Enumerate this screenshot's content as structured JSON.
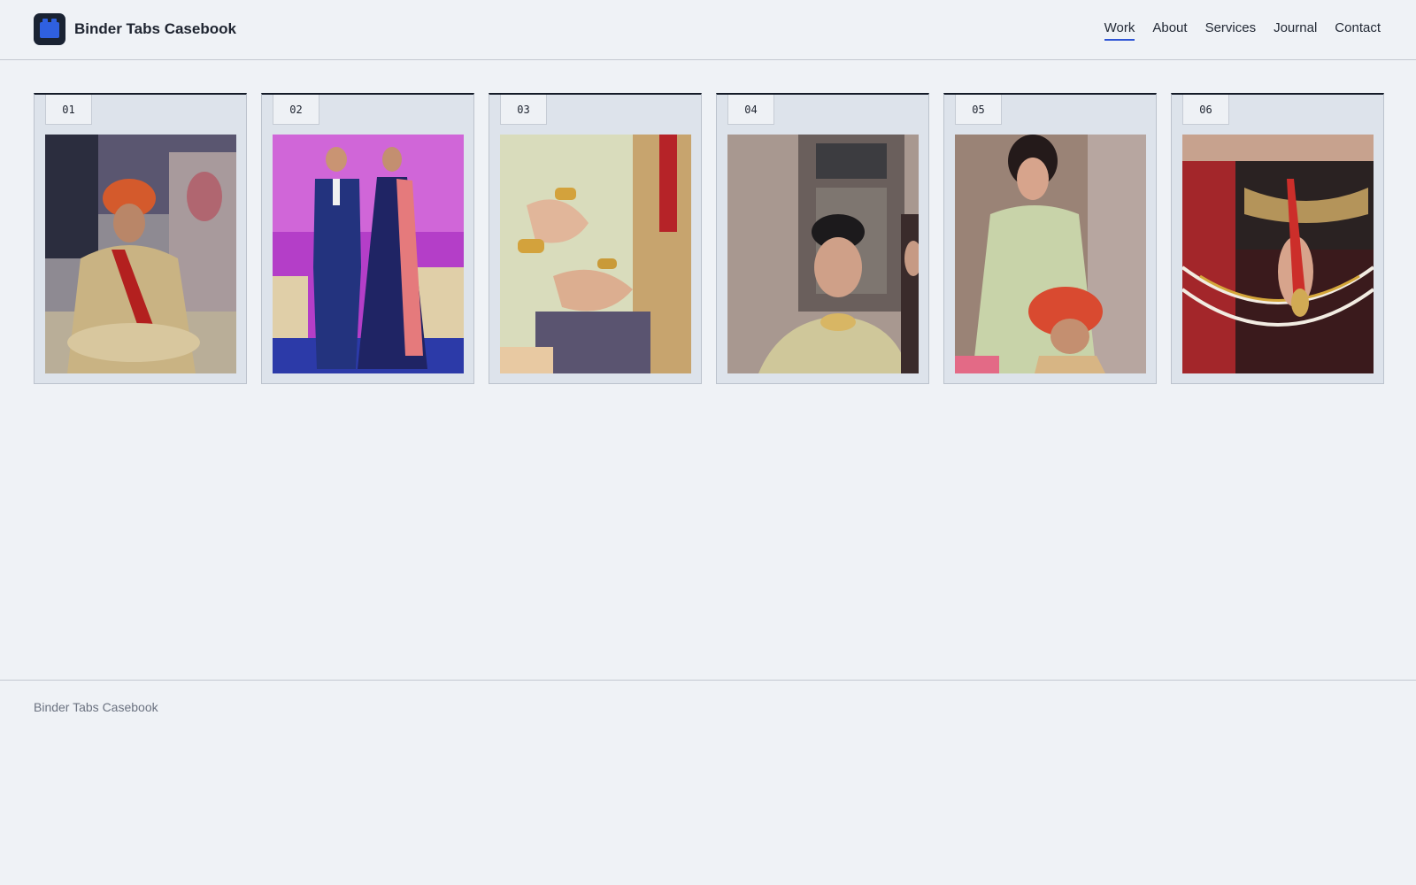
{
  "brand": {
    "title": "Binder Tabs Casebook",
    "logo_icon": "binder-tabs-icon"
  },
  "nav": {
    "items": [
      {
        "label": "Work",
        "active": true
      },
      {
        "label": "About",
        "active": false
      },
      {
        "label": "Services",
        "active": false
      },
      {
        "label": "Journal",
        "active": false
      },
      {
        "label": "Contact",
        "active": false
      }
    ]
  },
  "cards": [
    {
      "tab": "01"
    },
    {
      "tab": "02"
    },
    {
      "tab": "03"
    },
    {
      "tab": "04"
    },
    {
      "tab": "05"
    },
    {
      "tab": "06"
    }
  ],
  "footer": {
    "text": "Binder Tabs Casebook"
  },
  "colors": {
    "background": "#eff2f6",
    "accent": "#2f55d4",
    "card": "#dde3eb",
    "logo": "#1a2333"
  }
}
